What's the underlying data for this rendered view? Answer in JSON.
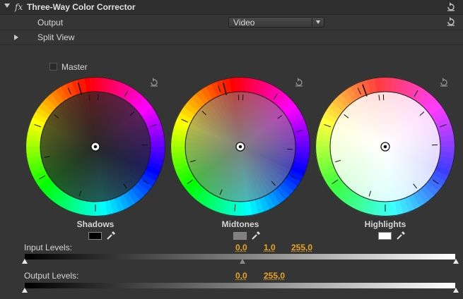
{
  "header": {
    "fx": "fx",
    "title": "Three-Way Color Corrector"
  },
  "output": {
    "label": "Output",
    "value": "Video"
  },
  "split_view": {
    "label": "Split View"
  },
  "master": {
    "label": "Master",
    "checked": false
  },
  "wheels": [
    {
      "label": "Shadows",
      "swatch": "#000000"
    },
    {
      "label": "Midtones",
      "swatch": "#808080"
    },
    {
      "label": "Highlights",
      "swatch": "#ffffff"
    }
  ],
  "input_levels": {
    "label": "Input Levels:",
    "black": "0,0",
    "gamma": "1,0",
    "white": "255,0"
  },
  "output_levels": {
    "label": "Output Levels:",
    "black": "0,0",
    "white": "255,0"
  },
  "colors": {
    "accent": "#e9a420",
    "panel": "#353535"
  }
}
